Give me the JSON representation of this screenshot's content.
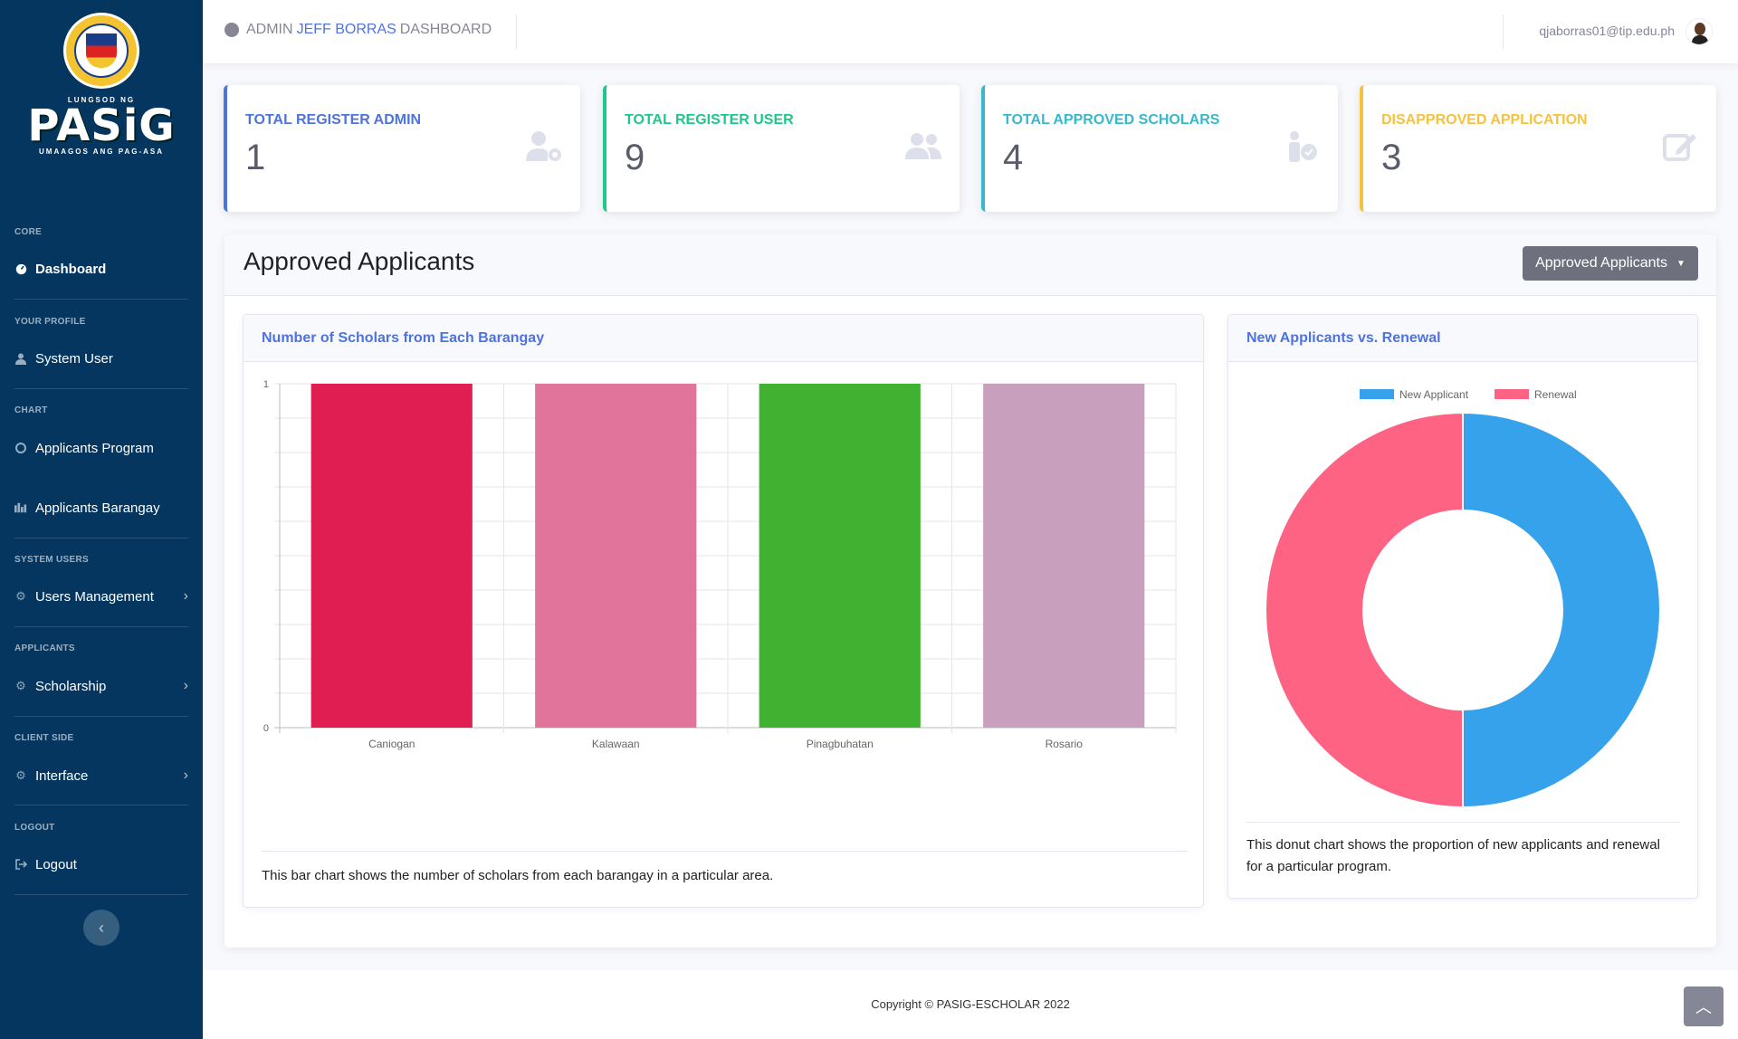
{
  "sidebar": {
    "logo": {
      "top_text": "LUNGSOD NG",
      "main_text": "PASiG",
      "tagline": "UMAAGOS ANG PAG-ASA",
      "seal_text": "NG PASIG, KALAKHANG MAYNILA 1573"
    },
    "sections": [
      {
        "heading": "CORE",
        "items": [
          {
            "label": "Dashboard",
            "icon": "tachometer-icon",
            "active": true
          }
        ]
      },
      {
        "heading": "YOUR PROFILE",
        "items": [
          {
            "label": "System User",
            "icon": "user-icon"
          }
        ]
      },
      {
        "heading": "CHART",
        "items": [
          {
            "label": "Applicants Program",
            "icon": "chart-pie-icon"
          },
          {
            "label": "Applicants Barangay",
            "icon": "chart-bar-icon"
          }
        ]
      },
      {
        "heading": "SYSTEM USERS",
        "items": [
          {
            "label": "Users Management",
            "icon": "cog-icon",
            "chevron": true
          }
        ]
      },
      {
        "heading": "APPLICANTS",
        "items": [
          {
            "label": "Scholarship",
            "icon": "cog-icon",
            "chevron": true
          }
        ]
      },
      {
        "heading": "CLIENT SIDE",
        "items": [
          {
            "label": "Interface",
            "icon": "cog-icon",
            "chevron": true
          }
        ]
      },
      {
        "heading": "LOGOUT",
        "items": [
          {
            "label": "Logout",
            "icon": "sign-out-icon"
          }
        ]
      }
    ]
  },
  "topbar": {
    "title_prefix": "ADMIN",
    "title_name": "JEFF BORRAS",
    "title_suffix": "DASHBOARD",
    "email": "qjaborras01@tip.edu.ph"
  },
  "stats": [
    {
      "label": "TOTAL REGISTER ADMIN",
      "value": "1",
      "color": "#4e73df",
      "icon": "user-cog-icon"
    },
    {
      "label": "TOTAL REGISTER USER",
      "value": "9",
      "color": "#1cc88a",
      "icon": "users-icon"
    },
    {
      "label": "TOTAL APPROVED SCHOLARS",
      "value": "4",
      "color": "#36b9cc",
      "icon": "user-check-icon"
    },
    {
      "label": "DISAPPROVED APPLICATION",
      "value": "3",
      "color": "#f6c23e",
      "icon": "edit-icon"
    }
  ],
  "panel": {
    "title": "Approved Applicants",
    "dropdown_label": "Approved Applicants"
  },
  "bar_card": {
    "title": "Number of Scholars from Each Barangay",
    "description": "This bar chart shows the number of scholars from each barangay in a particular area."
  },
  "donut_card": {
    "title": "New Applicants vs. Renewal",
    "description": "This donut chart shows the proportion of new applicants and renewal for a particular program."
  },
  "chart_data": [
    {
      "type": "bar",
      "categories": [
        "Caniogan",
        "Kalawaan",
        "Pinagbuhatan",
        "Rosario"
      ],
      "values": [
        1,
        1,
        1,
        1
      ],
      "colors": [
        "#e01e52",
        "#e0749a",
        "#41b132",
        "#c8a0be"
      ],
      "ylim": [
        0,
        1
      ],
      "yticks": [
        "0",
        "1"
      ],
      "grid": true
    },
    {
      "type": "pie",
      "subtype": "donut",
      "labels": [
        "New Applicant",
        "Renewal"
      ],
      "values": [
        1,
        1
      ],
      "colors": [
        "#36a2eb",
        "#ff6384"
      ],
      "legend": "top"
    }
  ],
  "footer": {
    "copyright": "Copyright © PASIG-ESCHOLAR 2022"
  }
}
